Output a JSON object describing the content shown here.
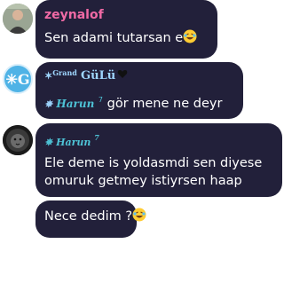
{
  "messages": [
    {
      "sender": "zeynalof",
      "text": "Sen adami tutarsan e"
    },
    {
      "sender_prefix": "Grand",
      "sender": "GüLü",
      "mention": "Harun",
      "mention_sup": "7",
      "text": " gör mene ne deyr"
    },
    {
      "sender": "Harun",
      "sender_sup": "7",
      "line1": "Ele deme is yoldasmdi sen diyese",
      "line2": "omuruk getmey istiyrsen haap"
    },
    {
      "text": "Nece dedim ?"
    }
  ],
  "avatars": [
    {
      "icon": "profile-photo"
    },
    {
      "text": "✳G"
    },
    {
      "icon": "lion-avatar"
    }
  ],
  "colors": {
    "bubble": "#22203a",
    "name_pink": "#f06aa5",
    "accent_cyan": "#4ec3d6",
    "light_blue": "#9fd6ff"
  }
}
